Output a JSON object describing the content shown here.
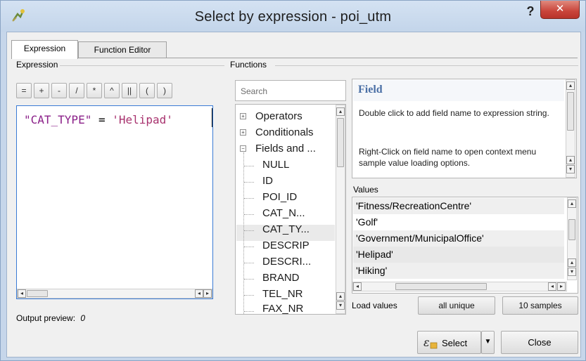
{
  "window": {
    "title": "Select by expression - poi_utm",
    "help_symbol": "?",
    "close_symbol": "✕"
  },
  "tabs": [
    {
      "label": "Expression",
      "active": true
    },
    {
      "label": "Function Editor",
      "active": false
    }
  ],
  "expression": {
    "group_label": "Expression",
    "operators": [
      "=",
      "+",
      "-",
      "/",
      "*",
      "^",
      "||",
      "(",
      ")"
    ],
    "tokens": {
      "field": "\"CAT_TYPE\"",
      "op": " = ",
      "string": "'Helipad'"
    },
    "output_preview_label": "Output preview:",
    "output_preview_value": "0"
  },
  "functions": {
    "group_label": "Functions",
    "search_placeholder": "Search",
    "tree": {
      "groups": [
        "Operators",
        "Conditionals",
        "Fields and ..."
      ],
      "fields": [
        "NULL",
        "ID",
        "POI_ID",
        "CAT_N...",
        "CAT_TY...",
        "DESCRIP",
        "DESCRI...",
        "BRAND",
        "TEL_NR",
        "FAX_NR"
      ],
      "selected_field": "CAT_TY..."
    }
  },
  "help": {
    "title": "Field",
    "line1": "Double click to add field name to expression string.",
    "line2": "Right-Click on field name to open context menu sample value loading options."
  },
  "values": {
    "label": "Values",
    "items": [
      "'Fitness/RecreationCentre'",
      "'Golf'",
      "'Government/MunicipalOffice'",
      "'Helipad'",
      "'Hiking'"
    ],
    "load_label": "Load values",
    "all_unique_label": "all unique",
    "samples_label": "10 samples"
  },
  "footer": {
    "select_label": "Select",
    "close_label": "Close"
  },
  "colors": {
    "title_bar": "#c6d6ea",
    "close_button": "#c9443a",
    "field_token": "#8b2089",
    "string_token": "#a8326e",
    "help_title": "#4a6fa5",
    "expression_focus_border": "#3a7bd5"
  }
}
